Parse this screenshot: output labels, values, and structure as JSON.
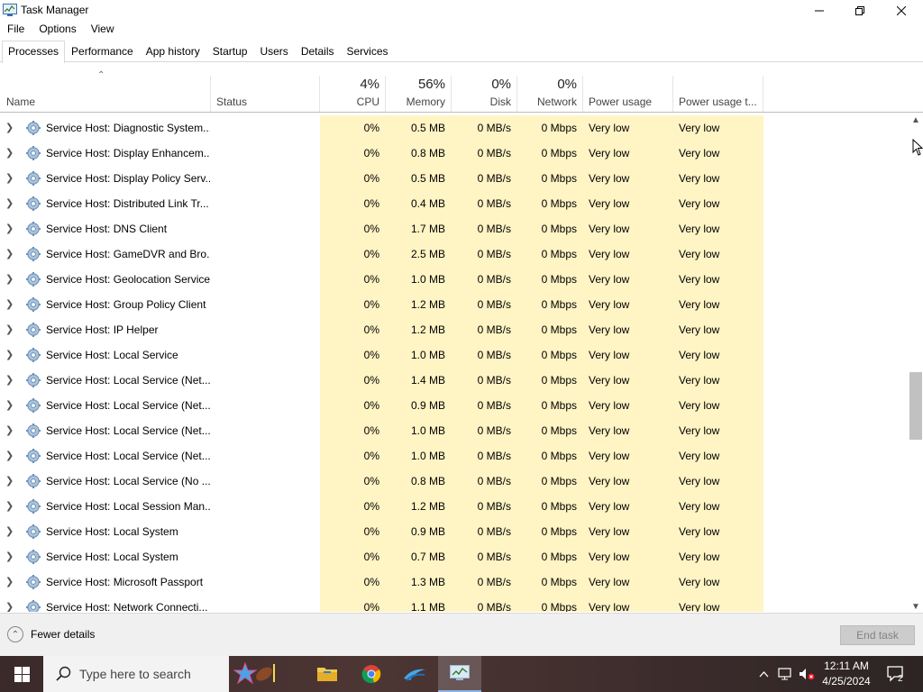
{
  "window": {
    "title": "Task Manager"
  },
  "menu": [
    "File",
    "Options",
    "View"
  ],
  "tabs": [
    "Processes",
    "Performance",
    "App history",
    "Startup",
    "Users",
    "Details",
    "Services"
  ],
  "header": {
    "name": "Name",
    "status": "Status",
    "cpu": {
      "pct": "4%",
      "label": "CPU"
    },
    "memory": {
      "pct": "56%",
      "label": "Memory"
    },
    "disk": {
      "pct": "0%",
      "label": "Disk"
    },
    "network": {
      "pct": "0%",
      "label": "Network"
    },
    "power": "Power usage",
    "power_trend": "Power usage t..."
  },
  "rows": [
    {
      "name": "Service Host: Diagnostic System...",
      "cpu": "0%",
      "mem": "0.5 MB",
      "disk": "0 MB/s",
      "net": "0 Mbps",
      "pow": "Very low",
      "powt": "Very low"
    },
    {
      "name": "Service Host: Display Enhancem...",
      "cpu": "0%",
      "mem": "0.8 MB",
      "disk": "0 MB/s",
      "net": "0 Mbps",
      "pow": "Very low",
      "powt": "Very low"
    },
    {
      "name": "Service Host: Display Policy Serv...",
      "cpu": "0%",
      "mem": "0.5 MB",
      "disk": "0 MB/s",
      "net": "0 Mbps",
      "pow": "Very low",
      "powt": "Very low"
    },
    {
      "name": "Service Host: Distributed Link Tr...",
      "cpu": "0%",
      "mem": "0.4 MB",
      "disk": "0 MB/s",
      "net": "0 Mbps",
      "pow": "Very low",
      "powt": "Very low"
    },
    {
      "name": "Service Host: DNS Client",
      "cpu": "0%",
      "mem": "1.7 MB",
      "disk": "0 MB/s",
      "net": "0 Mbps",
      "pow": "Very low",
      "powt": "Very low"
    },
    {
      "name": "Service Host: GameDVR and Bro...",
      "cpu": "0%",
      "mem": "2.5 MB",
      "disk": "0 MB/s",
      "net": "0 Mbps",
      "pow": "Very low",
      "powt": "Very low"
    },
    {
      "name": "Service Host: Geolocation Service",
      "cpu": "0%",
      "mem": "1.0 MB",
      "disk": "0 MB/s",
      "net": "0 Mbps",
      "pow": "Very low",
      "powt": "Very low"
    },
    {
      "name": "Service Host: Group Policy Client",
      "cpu": "0%",
      "mem": "1.2 MB",
      "disk": "0 MB/s",
      "net": "0 Mbps",
      "pow": "Very low",
      "powt": "Very low"
    },
    {
      "name": "Service Host: IP Helper",
      "cpu": "0%",
      "mem": "1.2 MB",
      "disk": "0 MB/s",
      "net": "0 Mbps",
      "pow": "Very low",
      "powt": "Very low"
    },
    {
      "name": "Service Host: Local Service",
      "cpu": "0%",
      "mem": "1.0 MB",
      "disk": "0 MB/s",
      "net": "0 Mbps",
      "pow": "Very low",
      "powt": "Very low"
    },
    {
      "name": "Service Host: Local Service (Net...",
      "cpu": "0%",
      "mem": "1.4 MB",
      "disk": "0 MB/s",
      "net": "0 Mbps",
      "pow": "Very low",
      "powt": "Very low"
    },
    {
      "name": "Service Host: Local Service (Net...",
      "cpu": "0%",
      "mem": "0.9 MB",
      "disk": "0 MB/s",
      "net": "0 Mbps",
      "pow": "Very low",
      "powt": "Very low"
    },
    {
      "name": "Service Host: Local Service (Net...",
      "cpu": "0%",
      "mem": "1.0 MB",
      "disk": "0 MB/s",
      "net": "0 Mbps",
      "pow": "Very low",
      "powt": "Very low"
    },
    {
      "name": "Service Host: Local Service (Net...",
      "cpu": "0%",
      "mem": "1.0 MB",
      "disk": "0 MB/s",
      "net": "0 Mbps",
      "pow": "Very low",
      "powt": "Very low"
    },
    {
      "name": "Service Host: Local Service (No ...",
      "cpu": "0%",
      "mem": "0.8 MB",
      "disk": "0 MB/s",
      "net": "0 Mbps",
      "pow": "Very low",
      "powt": "Very low"
    },
    {
      "name": "Service Host: Local Session Man...",
      "cpu": "0%",
      "mem": "1.2 MB",
      "disk": "0 MB/s",
      "net": "0 Mbps",
      "pow": "Very low",
      "powt": "Very low"
    },
    {
      "name": "Service Host: Local System",
      "cpu": "0%",
      "mem": "0.9 MB",
      "disk": "0 MB/s",
      "net": "0 Mbps",
      "pow": "Very low",
      "powt": "Very low"
    },
    {
      "name": "Service Host: Local System",
      "cpu": "0%",
      "mem": "0.7 MB",
      "disk": "0 MB/s",
      "net": "0 Mbps",
      "pow": "Very low",
      "powt": "Very low"
    },
    {
      "name": "Service Host: Microsoft Passport",
      "cpu": "0%",
      "mem": "1.3 MB",
      "disk": "0 MB/s",
      "net": "0 Mbps",
      "pow": "Very low",
      "powt": "Very low"
    },
    {
      "name": "Service Host: Network Connecti...",
      "cpu": "0%",
      "mem": "1.1 MB",
      "disk": "0 MB/s",
      "net": "0 Mbps",
      "pow": "Very low",
      "powt": "Very low"
    }
  ],
  "footer": {
    "fewer_details": "Fewer details",
    "end_task": "End task"
  },
  "taskbar": {
    "search_placeholder": "Type here to search",
    "time": "12:11 AM",
    "date": "4/25/2024",
    "notification_count": "2"
  },
  "colors": {
    "highlight_column": "#fff4c4",
    "taskbar_active": "#8ab6e8"
  }
}
